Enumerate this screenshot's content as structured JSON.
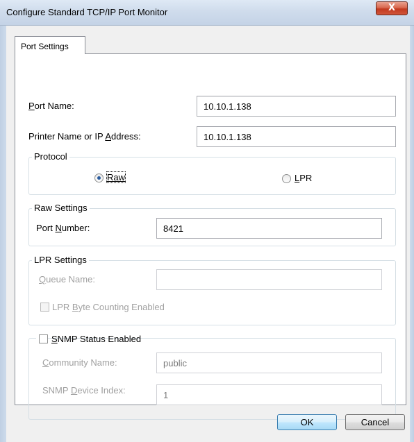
{
  "window": {
    "title": "Configure Standard TCP/IP Port Monitor",
    "close_glyph": "X"
  },
  "tab": {
    "label": "Port Settings"
  },
  "fields": {
    "port_name_label_u": "P",
    "port_name_label_rest": "ort Name:",
    "port_name_value": "10.10.1.138",
    "printer_label_pre": "Printer Name or IP ",
    "printer_label_u": "A",
    "printer_label_rest": "ddress:",
    "printer_value": "10.10.1.138"
  },
  "protocol": {
    "title": "Protocol",
    "raw_label": "Raw",
    "raw_selected": true,
    "lpr_label_u": "L",
    "lpr_label_rest": "PR"
  },
  "raw_settings": {
    "title": "Raw Settings",
    "port_number_label_pre": "Port ",
    "port_number_label_u": "N",
    "port_number_label_rest": "umber:",
    "port_number_value": "8421"
  },
  "lpr_settings": {
    "title": "LPR Settings",
    "queue_label_u": "Q",
    "queue_label_rest": "ueue Name:",
    "queue_value": "",
    "byte_count_label_pre": "LPR ",
    "byte_count_label_u": "B",
    "byte_count_label_rest": "yte Counting Enabled"
  },
  "snmp": {
    "title_u": "S",
    "title_rest": "NMP Status Enabled",
    "community_label_u": "C",
    "community_label_rest": "ommunity Name:",
    "community_value": "public",
    "device_index_label_pre": "SNMP ",
    "device_index_label_u": "D",
    "device_index_label_rest": "evice Index:",
    "device_index_value": "1"
  },
  "buttons": {
    "ok_label": "OK",
    "cancel_label": "Cancel"
  }
}
